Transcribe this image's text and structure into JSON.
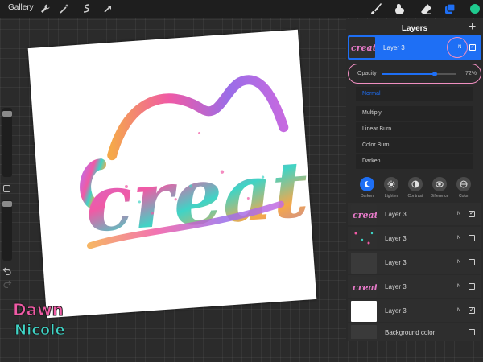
{
  "topbar": {
    "gallery_label": "Gallery",
    "left_tools": [
      "wrench-icon",
      "magic-wand-icon",
      "selection-icon",
      "transform-arrow-icon"
    ],
    "right_tools": [
      "brush-icon",
      "smudge-icon",
      "eraser-icon",
      "layers-icon"
    ],
    "color": "#1fca8f"
  },
  "sidebar": {
    "brush_size_level": 0.08,
    "opacity_level": 0.05
  },
  "canvas": {
    "word": "create",
    "accent_colors": [
      "#f05aa5",
      "#9a6de8",
      "#3fd4c6",
      "#f5a84a"
    ]
  },
  "logo": {
    "line1": "Dawn",
    "line2": "Nicole"
  },
  "layers_panel": {
    "title": "Layers",
    "add_icon": "+",
    "active_layer": {
      "name": "Layer 3",
      "blend_mode": "N",
      "visible": true
    },
    "opacity": {
      "label": "Opacity",
      "value_text": "72%",
      "value": 0.72
    },
    "blend_modes": [
      "Normal",
      "Multiply",
      "Linear Burn",
      "Color Burn",
      "Darken"
    ],
    "selected_blend_mode": "Normal",
    "mode_categories": [
      {
        "label": "Darken",
        "icon": "moon-icon",
        "active": true
      },
      {
        "label": "Lighten",
        "icon": "sun-icon",
        "active": false
      },
      {
        "label": "Contrast",
        "icon": "contrast-icon",
        "active": false
      },
      {
        "label": "Difference",
        "icon": "difference-icon",
        "active": false
      },
      {
        "label": "Color",
        "icon": "color-icon",
        "active": false
      }
    ],
    "layers": [
      {
        "name": "Layer 3",
        "blend": "N",
        "visible": true,
        "thumb": "lettering"
      },
      {
        "name": "Layer 3",
        "blend": "N",
        "visible": false,
        "thumb": "hearts"
      },
      {
        "name": "Layer 3",
        "blend": "N",
        "visible": false,
        "thumb": "dark"
      },
      {
        "name": "Layer 3",
        "blend": "N",
        "visible": false,
        "thumb": "lettering"
      },
      {
        "name": "Layer 3",
        "blend": "N",
        "visible": true,
        "thumb": "white"
      },
      {
        "name": "Background color",
        "blend": "",
        "visible": false,
        "thumb": "dark"
      }
    ]
  },
  "highlight_color": "#f08fc1",
  "accent_color": "#1e6ff5"
}
